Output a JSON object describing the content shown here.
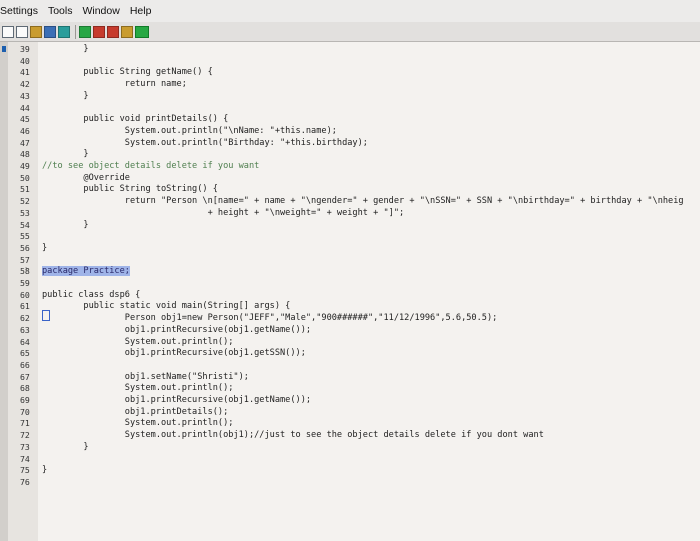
{
  "menu": [
    "Settings",
    "Tools",
    "Window",
    "Help"
  ],
  "toolbar_icons": [
    "new-file-icon",
    "open-file-icon",
    "run-icon",
    "chart-icon",
    "debug-icon",
    "add-icon",
    "bug-icon",
    "build-icon",
    "search-icon",
    "run-green-icon"
  ],
  "editor": {
    "lines": [
      {
        "num": "39",
        "text": "        }"
      },
      {
        "num": "40",
        "text": ""
      },
      {
        "num": "41",
        "text": "        public String getName() {"
      },
      {
        "num": "42",
        "text": "                return name;"
      },
      {
        "num": "43",
        "text": "        }"
      },
      {
        "num": "44",
        "text": ""
      },
      {
        "num": "45",
        "text": "        public void printDetails() {"
      },
      {
        "num": "46",
        "text": "                System.out.println(\"\\nName: \"+this.name);"
      },
      {
        "num": "47",
        "text": "                System.out.println(\"Birthday: \"+this.birthday);"
      },
      {
        "num": "48",
        "text": "        }"
      },
      {
        "num": "49",
        "text": "//to see object details delete if you want"
      },
      {
        "num": "50",
        "text": "        @Override"
      },
      {
        "num": "51",
        "text": "        public String toString() {"
      },
      {
        "num": "52",
        "text": "                return \"Person \\n[name=\" + name + \"\\ngender=\" + gender + \"\\nSSN=\" + SSN + \"\\nbirthday=\" + birthday + \"\\nheig"
      },
      {
        "num": "53",
        "text": "                                + height + \"\\nweight=\" + weight + \"]\";"
      },
      {
        "num": "54",
        "text": "        }"
      },
      {
        "num": "55",
        "text": ""
      },
      {
        "num": "56",
        "text": "}"
      },
      {
        "num": "57",
        "text": ""
      },
      {
        "num": "58",
        "text": "package Practice;"
      },
      {
        "num": "59",
        "text": ""
      },
      {
        "num": "60",
        "text": "public class dsp6 {"
      },
      {
        "num": "61",
        "text": "        public static void main(String[] args) {"
      },
      {
        "num": "62",
        "text": "                Person obj1=new Person(\"JEFF\",\"Male\",\"900######\",\"11/12/1996\",5.6,50.5);"
      },
      {
        "num": "63",
        "text": "                obj1.printRecursive(obj1.getName());"
      },
      {
        "num": "64",
        "text": "                System.out.println();"
      },
      {
        "num": "65",
        "text": "                obj1.printRecursive(obj1.getSSN());"
      },
      {
        "num": "66",
        "text": ""
      },
      {
        "num": "67",
        "text": "                obj1.setName(\"Shristi\");"
      },
      {
        "num": "68",
        "text": "                System.out.println();"
      },
      {
        "num": "69",
        "text": "                obj1.printRecursive(obj1.getName());"
      },
      {
        "num": "70",
        "text": "                obj1.printDetails();"
      },
      {
        "num": "71",
        "text": "                System.out.println();"
      },
      {
        "num": "72",
        "text": "                System.out.println(obj1);//just to see the object details delete if you dont want"
      },
      {
        "num": "73",
        "text": "        }"
      },
      {
        "num": "74",
        "text": ""
      },
      {
        "num": "75",
        "text": "}"
      },
      {
        "num": "76",
        "text": ""
      }
    ]
  }
}
